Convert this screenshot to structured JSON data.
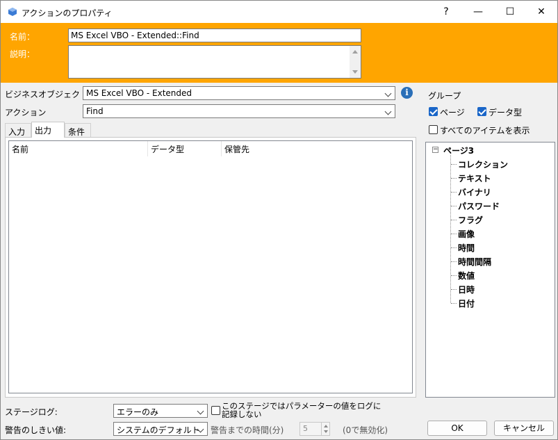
{
  "window": {
    "title": "アクションのプロパティ",
    "help_label": "?",
    "minimize_label": "—",
    "maximize_label": "☐",
    "close_label": "✕"
  },
  "header": {
    "name_label": "名前：",
    "name_value": "MS Excel VBO - Extended::Find",
    "description_label": "説明：",
    "description_value": ""
  },
  "business_object": {
    "label": "ビジネスオブジェクト",
    "value": "MS Excel VBO - Extended"
  },
  "action": {
    "label": "アクション",
    "value": "Find"
  },
  "tabs": [
    {
      "label": "入力"
    },
    {
      "label": "出力"
    },
    {
      "label": "条件"
    }
  ],
  "grid": {
    "columns": [
      "名前",
      "データ型",
      "保管先"
    ],
    "rows": []
  },
  "group": {
    "title": "グループ",
    "page_checkbox_label": "ページ",
    "datatype_checkbox_label": "データ型",
    "show_all_label": "すべてのアイテムを表示"
  },
  "tree": {
    "root": "ページ3",
    "items": [
      "コレクション",
      "テキスト",
      "バイナリ",
      "パスワード",
      "フラグ",
      "画像",
      "時間",
      "時間間隔",
      "数値",
      "日時",
      "日付"
    ]
  },
  "bottom": {
    "stage_log_label": "ステージログ:",
    "stage_log_value": "エラーのみ",
    "no_log_params_label": "このステージではパラメーターの値をログに記録しない",
    "warning_threshold_label": "警告のしきい値:",
    "warning_threshold_value": "システムのデフォルト",
    "warning_time_label": "警告までの時間(分)",
    "warning_time_value": "5",
    "warning_time_hint": "(0で無効化)",
    "ok_label": "OK",
    "cancel_label": "キャンセル"
  },
  "colors": {
    "header_bg": "#ffa500",
    "checkbox_accent": "#1a66c8",
    "info_icon": "#2a6fb8"
  }
}
